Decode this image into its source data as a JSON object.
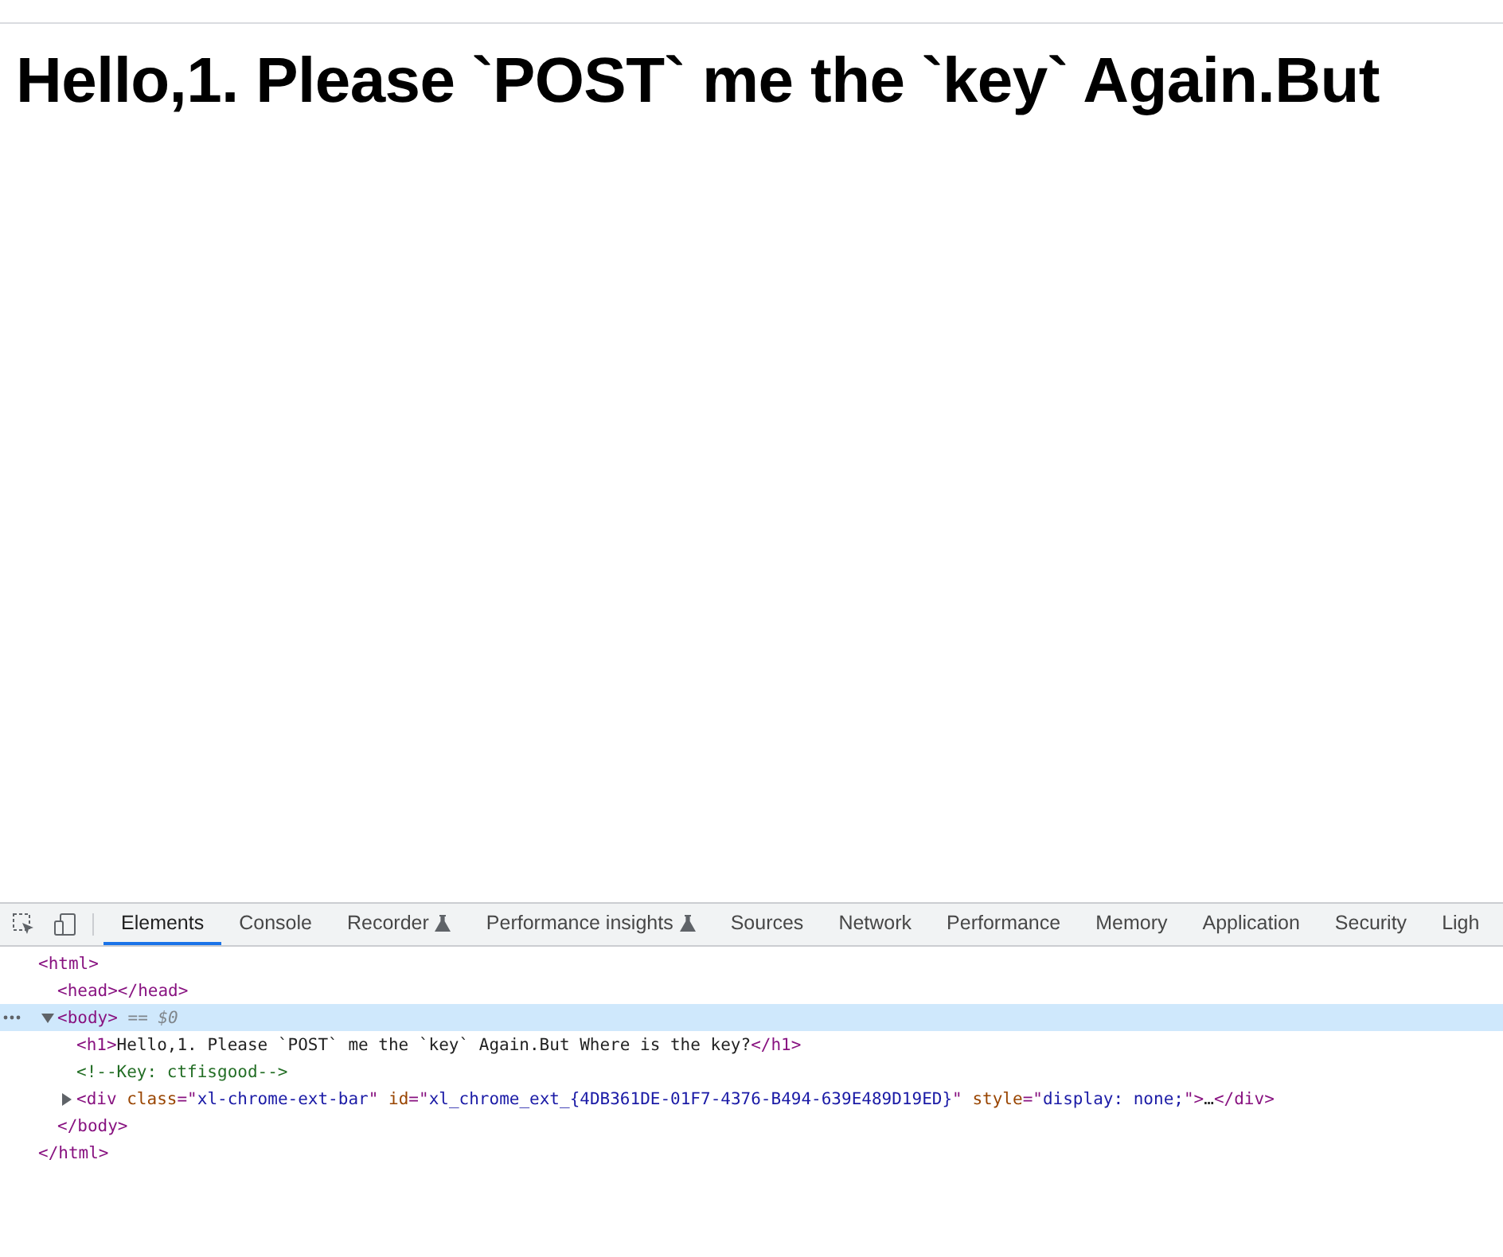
{
  "page": {
    "heading": "Hello,1. Please `POST` me the `key` Again.But"
  },
  "devtools": {
    "tabs": [
      {
        "label": "Elements",
        "selected": true,
        "experimental": false
      },
      {
        "label": "Console",
        "selected": false,
        "experimental": false
      },
      {
        "label": "Recorder",
        "selected": false,
        "experimental": true
      },
      {
        "label": "Performance insights",
        "selected": false,
        "experimental": true
      },
      {
        "label": "Sources",
        "selected": false,
        "experimental": false
      },
      {
        "label": "Network",
        "selected": false,
        "experimental": false
      },
      {
        "label": "Performance",
        "selected": false,
        "experimental": false
      },
      {
        "label": "Memory",
        "selected": false,
        "experimental": false
      },
      {
        "label": "Application",
        "selected": false,
        "experimental": false
      },
      {
        "label": "Security",
        "selected": false,
        "experimental": false
      },
      {
        "label": "Ligh",
        "selected": false,
        "experimental": false
      }
    ],
    "tree": [
      {
        "open": [
          {
            "kind": "tag",
            "text": "<html>"
          }
        ],
        "selected": false,
        "close": [
          {
            "kind": "tag",
            "text": "</html>"
          }
        ],
        "children": [
          {
            "open": [
              {
                "kind": "tag",
                "text": "<head></head>"
              }
            ],
            "selected": false
          },
          {
            "open": [
              {
                "kind": "tag",
                "text": "<body>"
              },
              {
                "kind": "ref",
                "text": " == $0"
              }
            ],
            "selected": true,
            "expanded": true,
            "close": [
              {
                "kind": "tag",
                "text": "</body>"
              }
            ],
            "children": [
              {
                "open": [
                  {
                    "kind": "tag",
                    "text": "<h1>"
                  },
                  {
                    "kind": "text",
                    "text": "Hello,1. Please `POST` me the `key` Again.But Where is the key?"
                  },
                  {
                    "kind": "tag",
                    "text": "</h1>"
                  }
                ],
                "selected": false
              },
              {
                "open": [
                  {
                    "kind": "comment",
                    "text": "<!--Key: ctfisgood-->"
                  }
                ],
                "selected": false
              },
              {
                "open": [
                  {
                    "kind": "tag",
                    "text": "<div "
                  },
                  {
                    "kind": "attr",
                    "text": "class"
                  },
                  {
                    "kind": "tag",
                    "text": "=\""
                  },
                  {
                    "kind": "value",
                    "text": "xl-chrome-ext-bar"
                  },
                  {
                    "kind": "tag",
                    "text": "\" "
                  },
                  {
                    "kind": "attr",
                    "text": "id"
                  },
                  {
                    "kind": "tag",
                    "text": "=\""
                  },
                  {
                    "kind": "value",
                    "text": "xl_chrome_ext_{4DB361DE-01F7-4376-B494-639E489D19ED}"
                  },
                  {
                    "kind": "tag",
                    "text": "\" "
                  },
                  {
                    "kind": "attr",
                    "text": "style"
                  },
                  {
                    "kind": "tag",
                    "text": "=\""
                  },
                  {
                    "kind": "value",
                    "text": "display: none;"
                  },
                  {
                    "kind": "tag",
                    "text": "\">"
                  },
                  {
                    "kind": "text",
                    "text": "…"
                  },
                  {
                    "kind": "tag",
                    "text": "</div>"
                  }
                ],
                "selected": false,
                "expanded": false
              }
            ]
          }
        ]
      }
    ]
  }
}
